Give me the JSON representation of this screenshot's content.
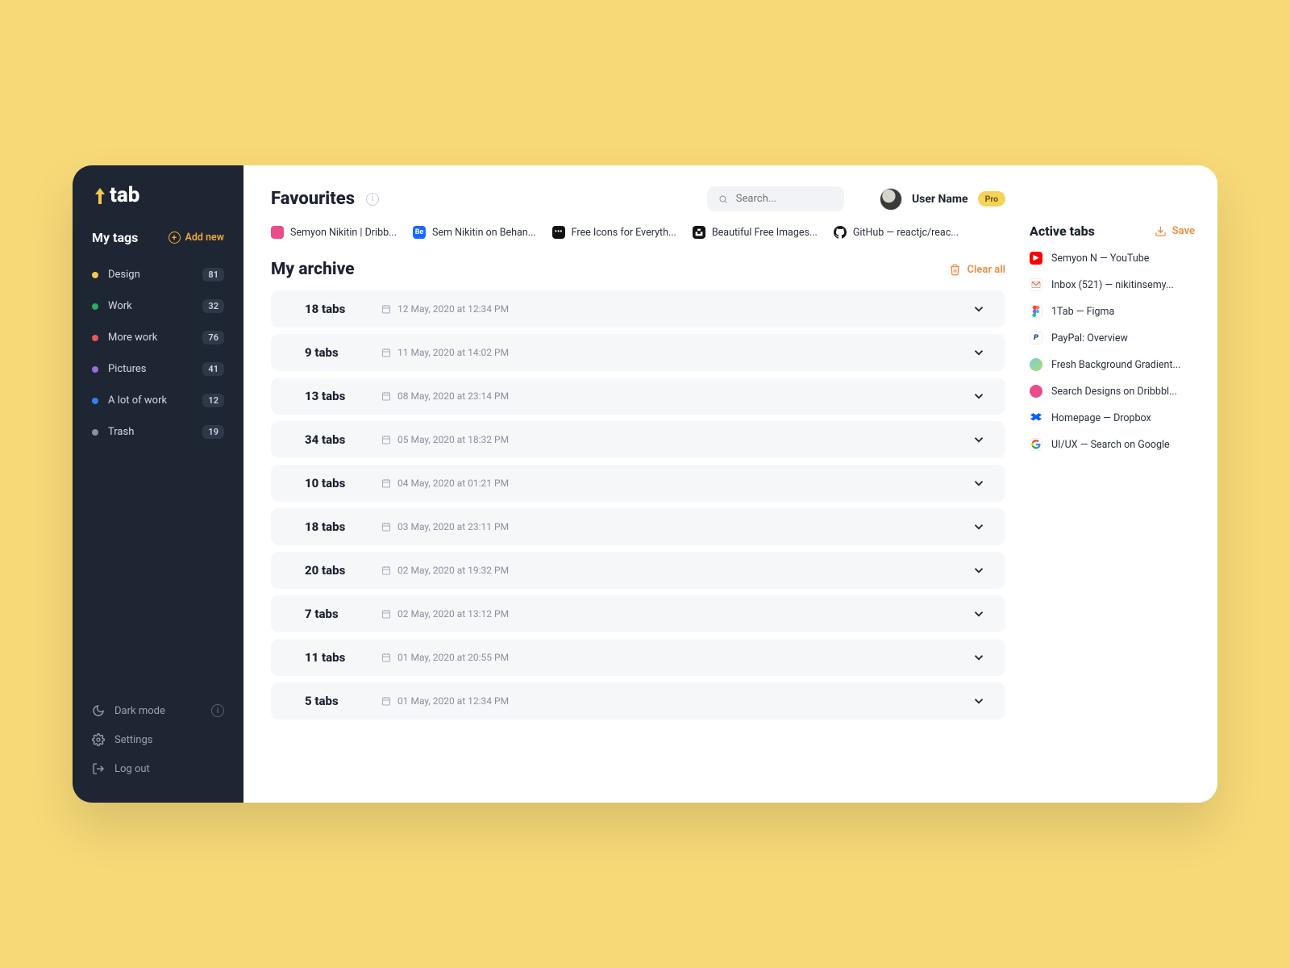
{
  "app_name": "tab",
  "sidebar": {
    "tags_title": "My tags",
    "add_new_label": "Add new",
    "items": [
      {
        "label": "Design",
        "count": "81",
        "color": "#f2c94c"
      },
      {
        "label": "Work",
        "count": "32",
        "color": "#27ae60"
      },
      {
        "label": "More work",
        "count": "76",
        "color": "#eb5757"
      },
      {
        "label": "Pictures",
        "count": "41",
        "color": "#9b6dd7"
      },
      {
        "label": "A lot of work",
        "count": "12",
        "color": "#2f80ed"
      },
      {
        "label": "Trash",
        "count": "19",
        "color": "#8a90a0"
      }
    ],
    "footer": {
      "dark_mode": "Dark mode",
      "settings": "Settings",
      "logout": "Log out"
    }
  },
  "header": {
    "favourites_title": "Favourites",
    "search_placeholder": "Search...",
    "user_name": "User Name",
    "pro_badge": "Pro"
  },
  "favourites": [
    {
      "label": "Semyon Nikitin | Dribb...",
      "icon_bg": "#ea4c89",
      "icon_txt": ""
    },
    {
      "label": "Sem Nikitin on Behan...",
      "icon_bg": "#1769ff",
      "icon_txt": "Be"
    },
    {
      "label": "Free Icons for Everyth...",
      "icon_bg": "#111111",
      "icon_txt": "•••"
    },
    {
      "label": "Beautiful Free Images...",
      "icon_bg": "#ffffff",
      "icon_txt": ""
    },
    {
      "label": "GitHub — reactjc/reac...",
      "icon_bg": "#181717",
      "icon_txt": ""
    }
  ],
  "archive": {
    "title": "My archive",
    "clear_all": "Clear all",
    "rows": [
      {
        "title": "18 tabs",
        "date": "12 May, 2020 at 12:34 PM"
      },
      {
        "title": "9 tabs",
        "date": "11 May, 2020 at 14:02 PM"
      },
      {
        "title": "13 tabs",
        "date": "08 May, 2020 at 23:14 PM"
      },
      {
        "title": "34 tabs",
        "date": "05 May, 2020 at 18:32 PM"
      },
      {
        "title": "10 tabs",
        "date": "04 May, 2020 at 01:21 PM"
      },
      {
        "title": "18 tabs",
        "date": "03 May, 2020 at 23:11 PM"
      },
      {
        "title": "20 tabs",
        "date": "02 May, 2020 at 19:32 PM"
      },
      {
        "title": "7 tabs",
        "date": "02 May, 2020 at 13:12 PM"
      },
      {
        "title": "11 tabs",
        "date": "01 May, 2020 at 20:55 PM"
      },
      {
        "title": "5 tabs",
        "date": "01 May, 2020 at 12:34 PM"
      }
    ]
  },
  "right": {
    "title": "Active tabs",
    "save_label": "Save",
    "items": [
      {
        "label": "Semyon N —  YouTube",
        "icon_bg": "#ff0000",
        "icon_txt": "▶"
      },
      {
        "label": "Inbox (521) —  nikitinsemy...",
        "icon_bg": "#ffffff",
        "icon_txt": "M"
      },
      {
        "label": "1Tab —  Figma",
        "icon_bg": "#ffffff",
        "icon_txt": ""
      },
      {
        "label": "PayPal: Overview",
        "icon_bg": "#ffffff",
        "icon_txt": "P"
      },
      {
        "label": "Fresh Background Gradient...",
        "icon_bg": "#6fb7e8",
        "icon_txt": ""
      },
      {
        "label": "Search Designs on Dribbbl...",
        "icon_bg": "#ea4c89",
        "icon_txt": ""
      },
      {
        "label": "Homepage —  Dropbox",
        "icon_bg": "#0061ff",
        "icon_txt": ""
      },
      {
        "label": "UI/UX — Search on Google",
        "icon_bg": "#ffffff",
        "icon_txt": "G"
      }
    ]
  }
}
